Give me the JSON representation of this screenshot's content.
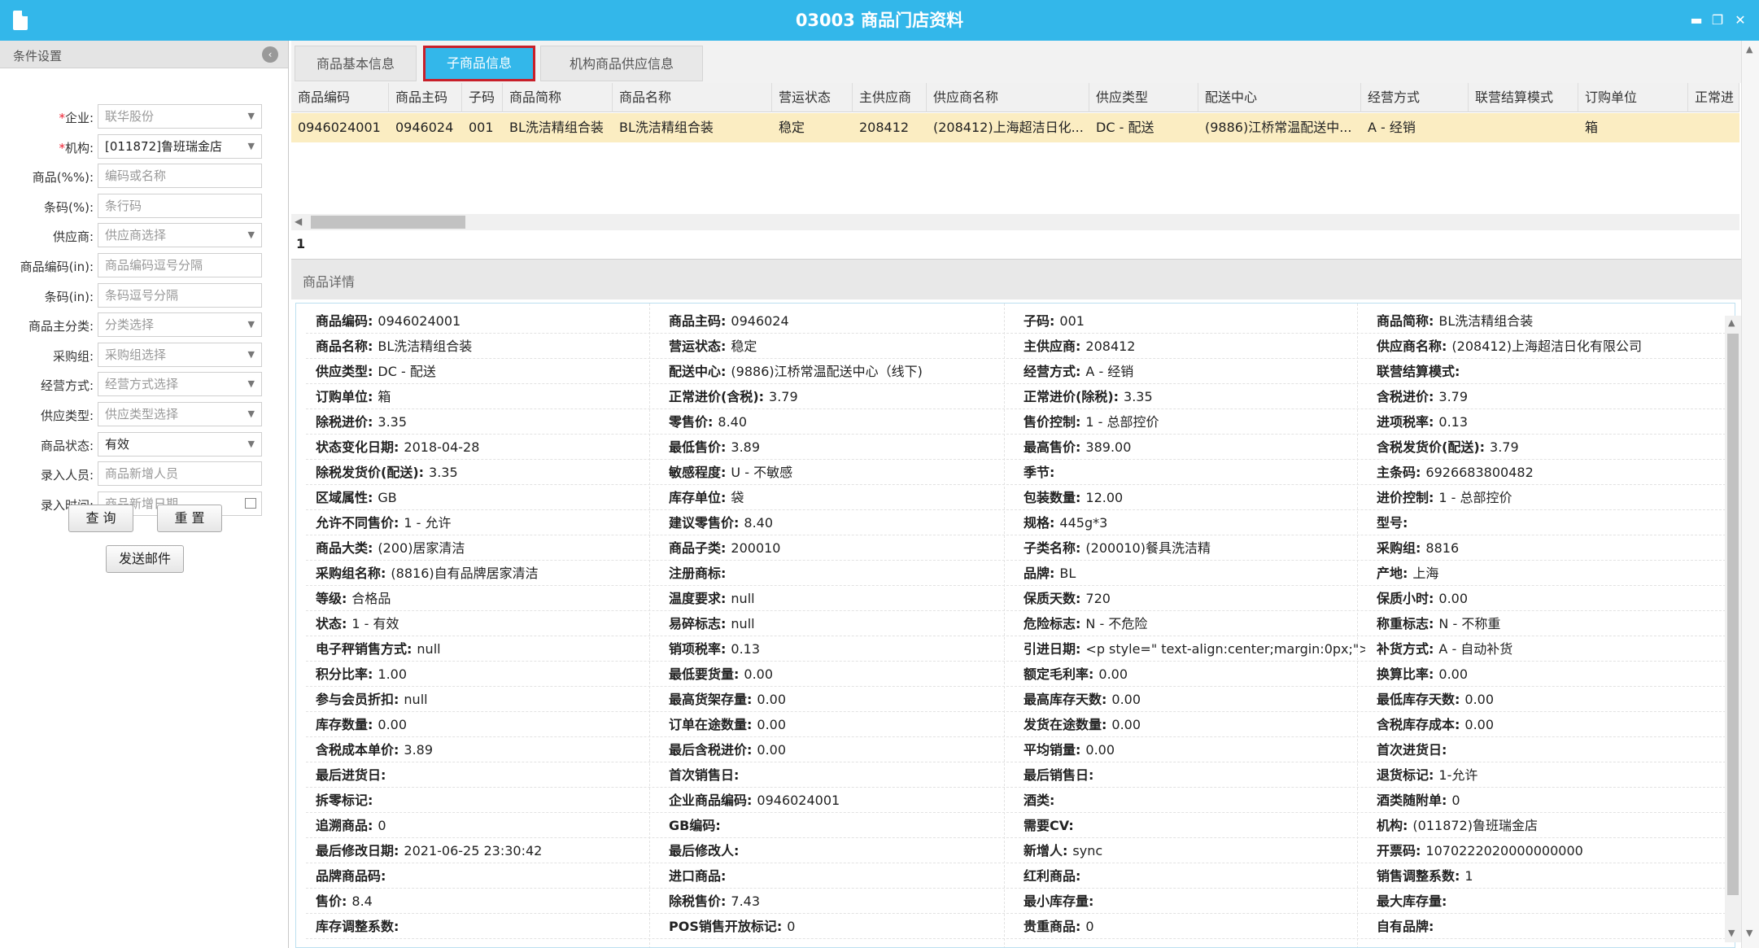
{
  "window": {
    "title": "03003 商品门店资料",
    "minimize": "▬",
    "restore": "❐",
    "close": "✕"
  },
  "left_panel": {
    "header": "条件设置",
    "collapse_icon": "‹",
    "filters": [
      {
        "label": "企业:",
        "required": true,
        "value": "联华股份",
        "kind": "select",
        "filled": false
      },
      {
        "label": "机构:",
        "required": true,
        "value": "[011872]鲁班瑞金店",
        "kind": "select",
        "filled": true
      },
      {
        "label": "商品(%%):",
        "required": false,
        "value": "编码或名称",
        "kind": "text",
        "filled": false
      },
      {
        "label": "条码(%):",
        "required": false,
        "value": "条行码",
        "kind": "text",
        "filled": false
      },
      {
        "label": "供应商:",
        "required": false,
        "value": "供应商选择",
        "kind": "select",
        "filled": false
      },
      {
        "label": "商品编码(in):",
        "required": false,
        "value": "商品编码逗号分隔",
        "kind": "text",
        "filled": false
      },
      {
        "label": "条码(in):",
        "required": false,
        "value": "条码逗号分隔",
        "kind": "text",
        "filled": false
      },
      {
        "label": "商品主分类:",
        "required": false,
        "value": "分类选择",
        "kind": "select",
        "filled": false
      },
      {
        "label": "采购组:",
        "required": false,
        "value": "采购组选择",
        "kind": "select",
        "filled": false
      },
      {
        "label": "经营方式:",
        "required": false,
        "value": "经营方式选择",
        "kind": "select",
        "filled": false
      },
      {
        "label": "供应类型:",
        "required": false,
        "value": "供应类型选择",
        "kind": "select",
        "filled": false
      },
      {
        "label": "商品状态:",
        "required": false,
        "value": "有效",
        "kind": "select",
        "filled": true
      },
      {
        "label": "录入人员:",
        "required": false,
        "value": "商品新增人员",
        "kind": "text",
        "filled": false
      },
      {
        "label": "录入时间:",
        "required": false,
        "value": "商品新增日期",
        "kind": "date",
        "filled": false
      }
    ],
    "query_button": "查 询",
    "reset_button": "重 置",
    "email_button": "发送邮件"
  },
  "tabs": [
    "商品基本信息",
    "子商品信息",
    "机构商品供应信息"
  ],
  "active_tab": 1,
  "grid": {
    "columns": [
      "商品编码",
      "商品主码",
      "子码",
      "商品简称",
      "商品名称",
      "营运状态",
      "主供应商",
      "供应商名称",
      "供应类型",
      "配送中心",
      "经营方式",
      "联营结算模式",
      "订购单位",
      "正常进"
    ],
    "rows": [
      [
        "0946024001",
        "0946024",
        "001",
        "BL洗洁精组合装",
        "BL洗洁精组合装",
        "稳定",
        "208412",
        "(208412)上海超洁日化...",
        "DC - 配送",
        "(9886)江桥常温配送中...",
        "A - 经销",
        "",
        "箱",
        ""
      ]
    ],
    "page": "1"
  },
  "detail": {
    "header": "商品详情",
    "rows": [
      [
        [
          "商品编码:",
          "0946024001"
        ],
        [
          "商品主码:",
          "0946024"
        ],
        [
          "子码:",
          "001"
        ],
        [
          "商品简称:",
          "BL洗洁精组合装"
        ]
      ],
      [
        [
          "商品名称:",
          "BL洗洁精组合装"
        ],
        [
          "营运状态:",
          "稳定"
        ],
        [
          "主供应商:",
          "208412"
        ],
        [
          "供应商名称:",
          "(208412)上海超洁日化有限公司"
        ]
      ],
      [
        [
          "供应类型:",
          "DC - 配送"
        ],
        [
          "配送中心:",
          "(9886)江桥常温配送中心（线下)"
        ],
        [
          "经营方式:",
          "A - 经销"
        ],
        [
          "联营结算模式:",
          ""
        ]
      ],
      [
        [
          "订购单位:",
          "箱"
        ],
        [
          "正常进价(含税):",
          "3.79"
        ],
        [
          "正常进价(除税):",
          "3.35"
        ],
        [
          "含税进价:",
          "3.79"
        ]
      ],
      [
        [
          "除税进价:",
          "3.35"
        ],
        [
          "零售价:",
          "8.40"
        ],
        [
          "售价控制:",
          "1 - 总部控价"
        ],
        [
          "进项税率:",
          "0.13"
        ]
      ],
      [
        [
          "状态变化日期:",
          "2018-04-28"
        ],
        [
          "最低售价:",
          "3.89"
        ],
        [
          "最高售价:",
          "389.00"
        ],
        [
          "含税发货价(配送):",
          "3.79"
        ]
      ],
      [
        [
          "除税发货价(配送):",
          "3.35"
        ],
        [
          "敏感程度:",
          "U - 不敏感"
        ],
        [
          "季节:",
          ""
        ],
        [
          "主条码:",
          "6926683800482"
        ]
      ],
      [
        [
          "区域属性:",
          "GB"
        ],
        [
          "库存单位:",
          "袋"
        ],
        [
          "包装数量:",
          "12.00"
        ],
        [
          "进价控制:",
          "1 - 总部控价"
        ]
      ],
      [
        [
          "允许不同售价:",
          "1 - 允许"
        ],
        [
          "建议零售价:",
          "8.40"
        ],
        [
          "规格:",
          "445g*3"
        ],
        [
          "型号:",
          ""
        ]
      ],
      [
        [
          "商品大类:",
          "(200)居家清洁"
        ],
        [
          "商品子类:",
          "200010"
        ],
        [
          "子类名称:",
          "(200010)餐具洗洁精"
        ],
        [
          "采购组:",
          "8816"
        ]
      ],
      [
        [
          "采购组名称:",
          "(8816)自有品牌居家清洁"
        ],
        [
          "注册商标:",
          ""
        ],
        [
          "品牌:",
          "BL"
        ],
        [
          "产地:",
          "上海"
        ]
      ],
      [
        [
          "等级:",
          "合格品"
        ],
        [
          "温度要求:",
          "null"
        ],
        [
          "保质天数:",
          "720"
        ],
        [
          "保质小时:",
          "0.00"
        ]
      ],
      [
        [
          "状态:",
          "1 - 有效"
        ],
        [
          "易碎标志:",
          "null"
        ],
        [
          "危险标志:",
          "N - 不危险"
        ],
        [
          "称重标志:",
          "N - 不称重"
        ]
      ],
      [
        [
          "电子秤销售方式:",
          "null"
        ],
        [
          "销项税率:",
          "0.13"
        ],
        [
          "引进日期:",
          "<p style=\" text-align:center;margin:0px;\">"
        ],
        [
          "补货方式:",
          "A - 自动补货"
        ]
      ],
      [
        [
          "积分比率:",
          "1.00"
        ],
        [
          "最低要货量:",
          "0.00"
        ],
        [
          "额定毛利率:",
          "0.00"
        ],
        [
          "换算比率:",
          "0.00"
        ]
      ],
      [
        [
          "参与会员折扣:",
          "null"
        ],
        [
          "最高货架存量:",
          "0.00"
        ],
        [
          "最高库存天数:",
          "0.00"
        ],
        [
          "最低库存天数:",
          "0.00"
        ]
      ],
      [
        [
          "库存数量:",
          "0.00"
        ],
        [
          "订单在途数量:",
          "0.00"
        ],
        [
          "发货在途数量:",
          "0.00"
        ],
        [
          "含税库存成本:",
          "0.00"
        ]
      ],
      [
        [
          "含税成本单价:",
          "3.89"
        ],
        [
          "最后含税进价:",
          "0.00"
        ],
        [
          "平均销量:",
          "0.00"
        ],
        [
          "首次进货日:",
          ""
        ]
      ],
      [
        [
          "最后进货日:",
          ""
        ],
        [
          "首次销售日:",
          ""
        ],
        [
          "最后销售日:",
          ""
        ],
        [
          "退货标记:",
          "1-允许"
        ]
      ],
      [
        [
          "拆零标记:",
          ""
        ],
        [
          "企业商品编码:",
          "0946024001"
        ],
        [
          "酒类:",
          ""
        ],
        [
          "酒类随附单:",
          "0"
        ]
      ],
      [
        [
          "追溯商品:",
          "0"
        ],
        [
          "GB编码:",
          ""
        ],
        [
          "需要CV:",
          ""
        ],
        [
          "机构:",
          "(011872)鲁班瑞金店"
        ]
      ],
      [
        [
          "最后修改日期:",
          "2021-06-25 23:30:42"
        ],
        [
          "最后修改人:",
          ""
        ],
        [
          "新增人:",
          "sync"
        ],
        [
          "开票码:",
          "1070222020000000000"
        ]
      ],
      [
        [
          "品牌商品码:",
          ""
        ],
        [
          "进口商品:",
          ""
        ],
        [
          "红利商品:",
          ""
        ],
        [
          "销售调整系数:",
          "1"
        ]
      ],
      [
        [
          "售价:",
          "8.4"
        ],
        [
          "除税售价:",
          "7.43"
        ],
        [
          "最小库存量:",
          ""
        ],
        [
          "最大库存量:",
          ""
        ]
      ],
      [
        [
          "库存调整系数:",
          ""
        ],
        [
          "POS销售开放标记:",
          "0"
        ],
        [
          "贵重商品:",
          "0"
        ],
        [
          "自有品牌:",
          ""
        ]
      ]
    ]
  }
}
